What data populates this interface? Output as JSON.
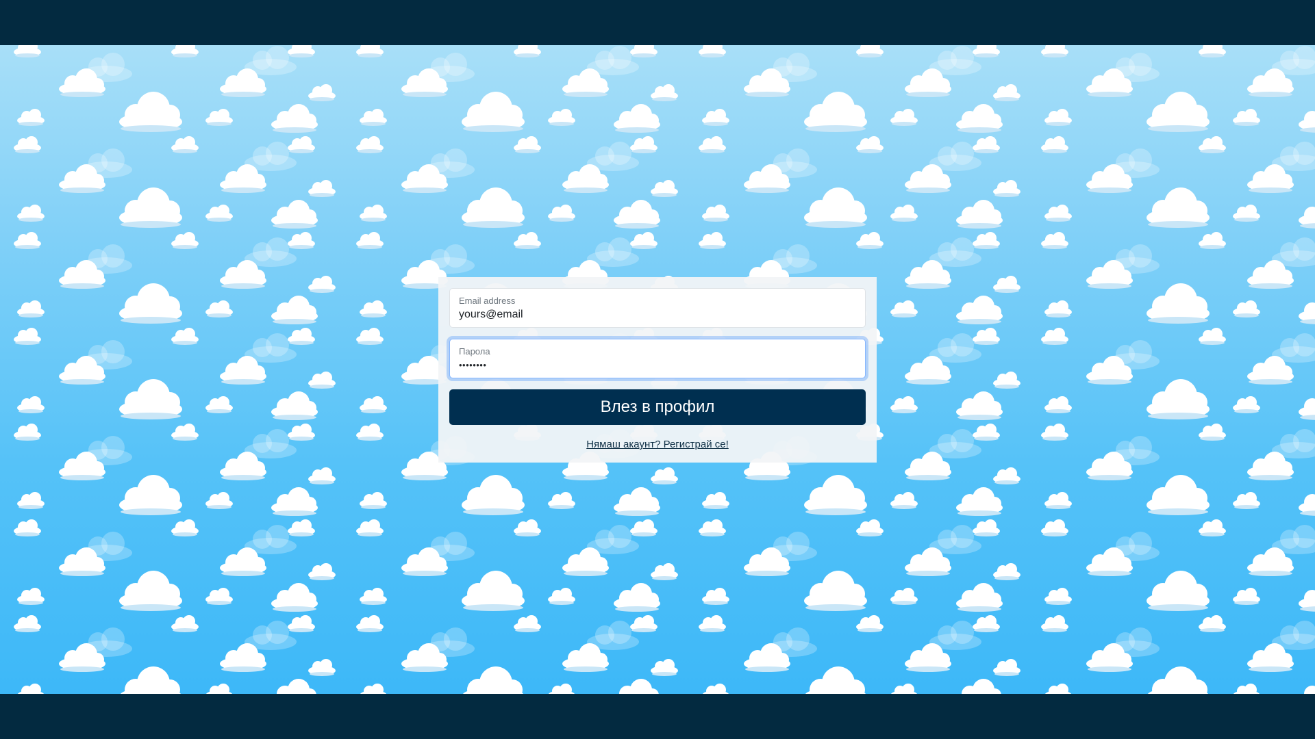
{
  "login_form": {
    "email_label": "Email address",
    "email_value": "yours@email",
    "password_label": "Парола",
    "password_value": "••••••••",
    "submit_label": "Влез в профил",
    "register_link": "Нямаш акаунт? Регистрай се!"
  },
  "colors": {
    "frame": "#032a40",
    "button": "#002f50",
    "sky_top": "#a8dff8",
    "sky_bottom": "#3db8f8"
  },
  "icons": {
    "background": "cloud-pattern"
  }
}
